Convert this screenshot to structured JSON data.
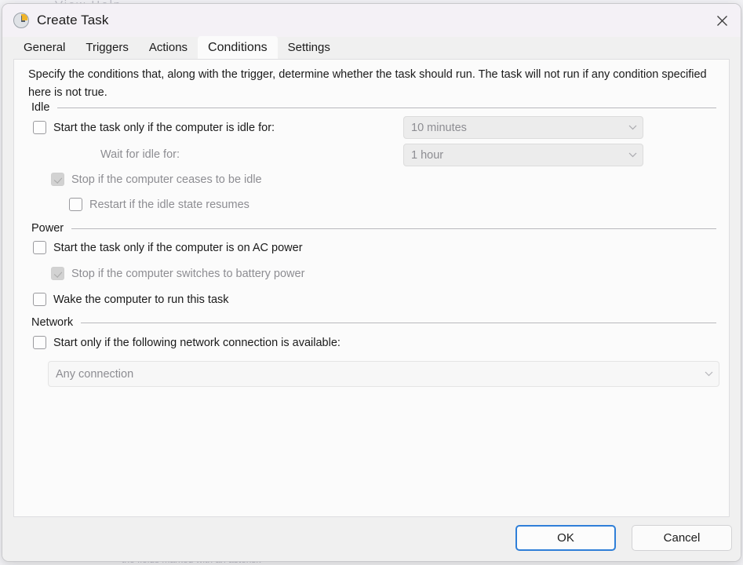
{
  "background": {
    "menu_hint": "View    Help",
    "bottom_hint": "the fields marked with an asterisk"
  },
  "window": {
    "title": "Create Task",
    "icon": "clock-icon",
    "close_label": "Close"
  },
  "tabs": [
    {
      "label": "General",
      "active": false
    },
    {
      "label": "Triggers",
      "active": false
    },
    {
      "label": "Actions",
      "active": false
    },
    {
      "label": "Conditions",
      "active": true
    },
    {
      "label": "Settings",
      "active": false
    }
  ],
  "content": {
    "description": "Specify the conditions that, along with the trigger, determine whether the task should run.  The task will not run  if any condition specified here is not true.",
    "groups": {
      "idle": {
        "label": "Idle",
        "start_if_idle": {
          "label": "Start the task only if the computer is idle for:",
          "checked": false,
          "enabled": true
        },
        "idle_duration": {
          "value": "10 minutes",
          "enabled": false
        },
        "wait_for_idle_label": "Wait for idle for:",
        "wait_duration": {
          "value": "1 hour",
          "enabled": false
        },
        "stop_if_ceases_idle": {
          "label": "Stop if the computer ceases to be idle",
          "checked": true,
          "enabled": false
        },
        "restart_if_idle_resumes": {
          "label": "Restart if the idle state resumes",
          "checked": false,
          "enabled": false
        }
      },
      "power": {
        "label": "Power",
        "start_if_ac": {
          "label": "Start the task only if the computer is on AC power",
          "checked": false,
          "enabled": true
        },
        "stop_if_battery": {
          "label": "Stop if the computer switches to battery power",
          "checked": true,
          "enabled": false
        },
        "wake_computer": {
          "label": "Wake the computer to run this task",
          "checked": false,
          "enabled": true
        }
      },
      "network": {
        "label": "Network",
        "start_if_network": {
          "label": "Start only if the following network connection is available:",
          "checked": false,
          "enabled": true
        },
        "connection": {
          "value": "Any connection",
          "enabled": false
        }
      }
    }
  },
  "footer": {
    "ok_label": "OK",
    "cancel_label": "Cancel"
  },
  "colors": {
    "accent": "#2f7fd8",
    "panel_bg": "#fbfbfb",
    "dialog_bg": "#f0f0f0",
    "disabled_text": "#8d8d92"
  }
}
